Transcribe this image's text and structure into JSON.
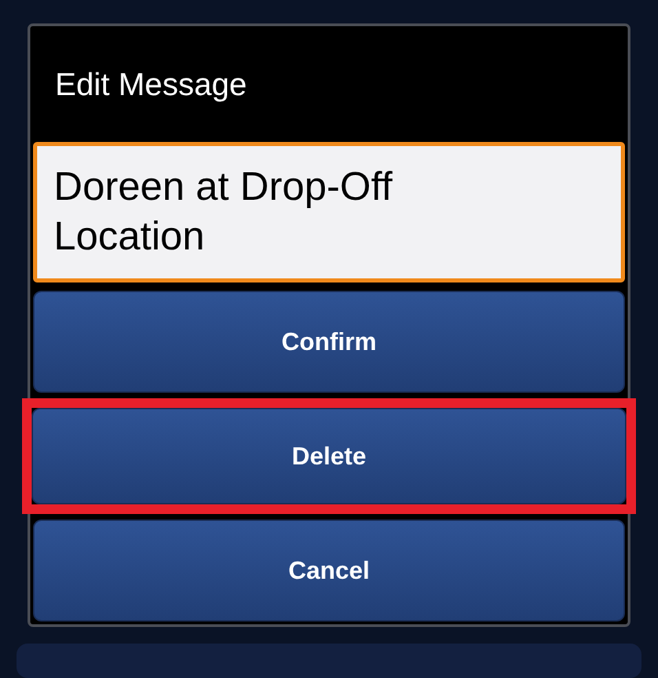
{
  "dialog": {
    "title": "Edit Message",
    "message_field": {
      "value": "Doreen at Drop-Off Location"
    },
    "buttons": [
      {
        "label": "Confirm",
        "highlighted": false
      },
      {
        "label": "Delete",
        "highlighted": true
      },
      {
        "label": "Cancel",
        "highlighted": false
      }
    ]
  }
}
